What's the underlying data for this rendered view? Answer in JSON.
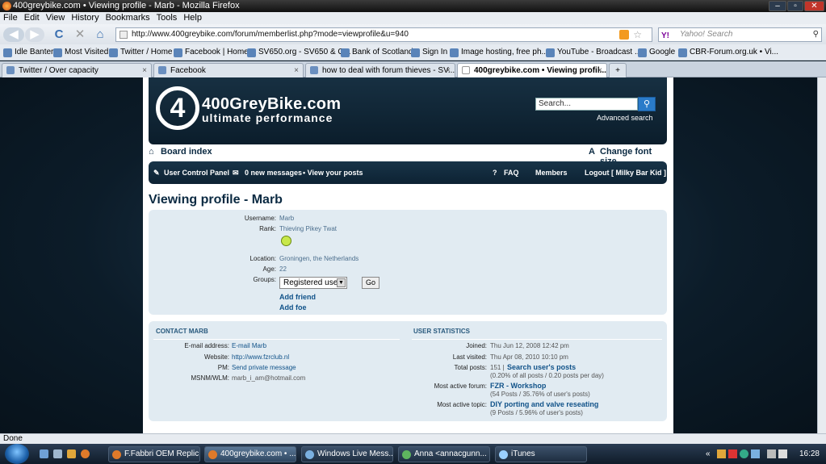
{
  "window": {
    "title": "400greybike.com • Viewing profile - Marb - Mozilla Firefox",
    "min": "–",
    "max": "▫",
    "close": "✕"
  },
  "menu": [
    "File",
    "Edit",
    "View",
    "History",
    "Bookmarks",
    "Tools",
    "Help"
  ],
  "nav": {
    "back": "◀",
    "forward": "▶",
    "reload": "C",
    "stop": "✕",
    "home": "⌂",
    "url": "http://www.400greybike.com/forum/memberlist.php?mode=viewprofile&u=940",
    "search_placeholder": "Yahoo! Search"
  },
  "bookmarks": [
    "Idle Banter",
    "Most Visited",
    "Twitter / Home",
    "Facebook | Home",
    "SV650.org - SV650 & G...",
    "Bank of Scotland",
    "Sign In",
    "Image hosting, free ph...",
    "YouTube - Broadcast ...",
    "Google",
    "CBR-Forum.org.uk • Vi..."
  ],
  "tabs": [
    "Twitter / Over capacity",
    "Facebook",
    "how to deal with forum thieves - SV...",
    "400greybike.com • Viewing profil..."
  ],
  "site": {
    "logo_mark": "4",
    "logo_title": "400GreyBike.com",
    "logo_sub": "ultimate performance",
    "search_placeholder": "Search...",
    "advanced_search": "Advanced search",
    "board_index": "Board index",
    "change_font": "Change font size",
    "nav": {
      "ucp": "User Control Panel",
      "messages": "0 new messages",
      "view_posts": "• View your posts",
      "faq": "FAQ",
      "members": "Members",
      "logout": "Logout [ Milky Bar Kid ]"
    }
  },
  "profile": {
    "heading": "Viewing profile - Marb",
    "username_label": "Username:",
    "username": "Marb",
    "rank_label": "Rank:",
    "rank": "Thieving Pikey Twat",
    "location_label": "Location:",
    "location": "Groningen, the Netherlands",
    "age_label": "Age:",
    "age": "22",
    "groups_label": "Groups:",
    "group_selected": "Registered users",
    "go": "Go",
    "add_friend": "Add friend",
    "add_foe": "Add foe"
  },
  "contact": {
    "heading": "CONTACT MARB",
    "email_label": "E-mail address:",
    "email": "E-mail Marb",
    "website_label": "Website:",
    "website": "http://www.fzrclub.nl",
    "pm_label": "PM:",
    "pm": "Send private message",
    "msn_label": "MSNM/WLM:",
    "msn": "marb_i_am@hotmail.com"
  },
  "stats": {
    "heading": "USER STATISTICS",
    "joined_label": "Joined:",
    "joined": "Thu Jun 12, 2008 12:42 pm",
    "lastvisit_label": "Last visited:",
    "lastvisit": "Thu Apr 08, 2010 10:10 pm",
    "posts_label": "Total posts:",
    "posts": "151 |",
    "search_posts": "Search user's posts",
    "posts_pct": "(0.20% of all posts / 0.20 posts per day)",
    "forum_label": "Most active forum:",
    "forum": "FZR - Workshop",
    "forum_pct": "(54 Posts / 35.76% of user's posts)",
    "topic_label": "Most active topic:",
    "topic": "DIY porting and valve reseating",
    "topic_pct": "(9 Posts / 5.96% of user's posts)"
  },
  "status": "Done",
  "taskbar": {
    "tasks": [
      "F.Fabbri OEM Replic...",
      "400greybike.com • ...",
      "Windows Live Mess...",
      "Anna <annacgunn...",
      "iTunes"
    ],
    "clock": "16:28",
    "tray": "«"
  }
}
